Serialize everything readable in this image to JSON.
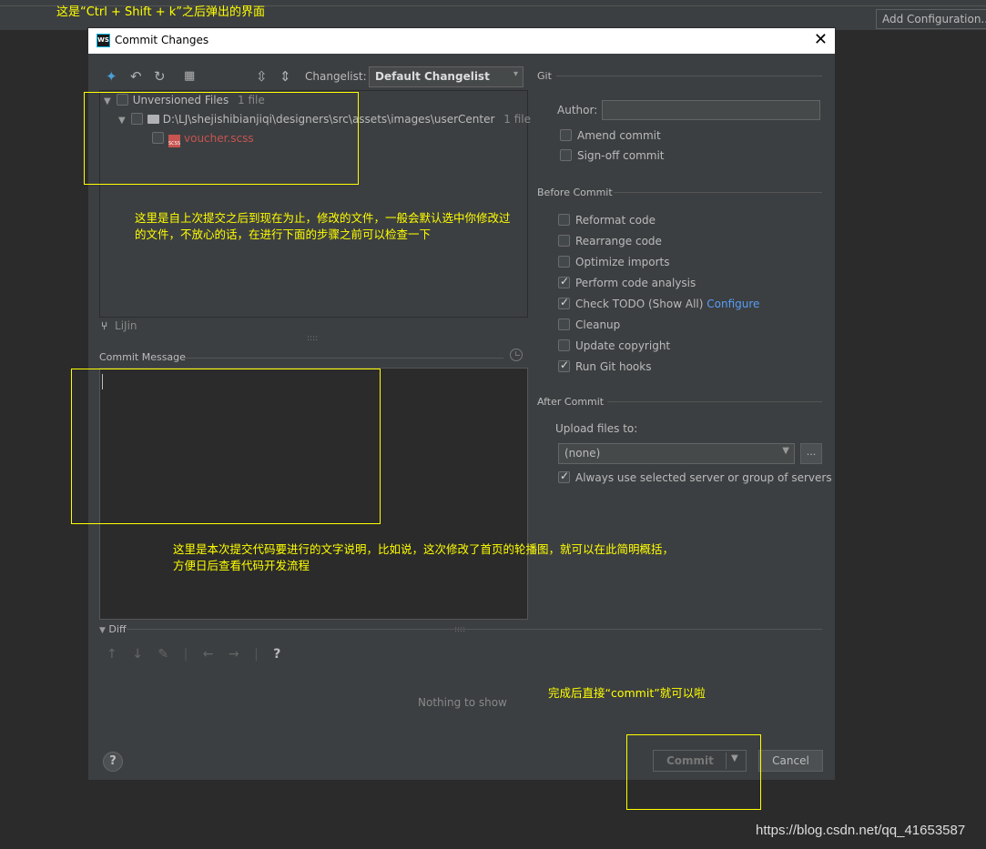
{
  "annotations": {
    "top": "这是“Ctrl + Shift + k”之后弹出的界面",
    "files_line1": "这里是自上次提交之后到现在为止，修改的文件，一般会默认选中你修改过",
    "files_line2": "的文件，不放心的话，在进行下面的步骤之前可以检查一下",
    "message_line1": "这里是本次提交代码要进行的文字说明，比如说，这次修改了首页的轮播图，就可以在此简明概括，",
    "message_line2": "方便日后查看代码开发流程",
    "commit": "完成后直接“commit”就可以啦"
  },
  "ide": {
    "add_configuration": "Add Configuration..."
  },
  "dialog": {
    "logo": "WS",
    "title": "Commit Changes",
    "close": "✕"
  },
  "toolbar": {
    "changelist_label": "Changelist:",
    "changelist_value": "Default Changelist"
  },
  "tree": {
    "root_label": "Unversioned Files",
    "root_count": "1 file",
    "folder_path": "D:\\LJ\\shejishibianjiqi\\designers\\src\\assets\\images\\userCenter",
    "folder_count": "1 file",
    "file_name": "voucher.scss",
    "file_icon": "SCSS"
  },
  "author_name": "LiJin",
  "commit_message": {
    "label": "Commit Message",
    "value": ""
  },
  "git": {
    "section": "Git",
    "author_label": "Author:",
    "author_value": "",
    "amend": "Amend commit",
    "signoff": "Sign-off commit"
  },
  "before_commit": {
    "section": "Before Commit",
    "items": [
      {
        "label": "Reformat code",
        "checked": false
      },
      {
        "label": "Rearrange code",
        "checked": false
      },
      {
        "label": "Optimize imports",
        "checked": false
      },
      {
        "label": "Perform code analysis",
        "checked": true
      },
      {
        "label": "Check TODO (Show All)",
        "checked": true,
        "link": "Configure"
      },
      {
        "label": "Cleanup",
        "checked": false
      },
      {
        "label": "Update copyright",
        "checked": false
      },
      {
        "label": "Run Git hooks",
        "checked": true
      }
    ]
  },
  "after_commit": {
    "section": "After Commit",
    "upload_label": "Upload files to:",
    "upload_value": "(none)",
    "dots": "...",
    "always_use": "Always use selected server or group of servers"
  },
  "diff": {
    "label": "Diff",
    "nothing": "Nothing to show",
    "help": "?"
  },
  "buttons": {
    "help": "?",
    "commit": "Commit",
    "cancel": "Cancel"
  },
  "watermark": "https://blog.csdn.net/qq_41653587"
}
